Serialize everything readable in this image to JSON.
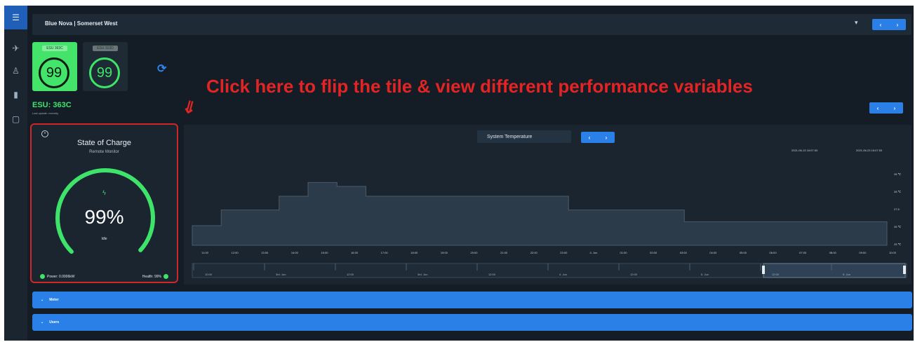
{
  "header": {
    "title": "Blue Nova | Somerset West",
    "nav_prev": "‹",
    "nav_next": "›"
  },
  "tiles": [
    {
      "label": "ESU 363C",
      "value": "99",
      "bg": "#44e46b",
      "ring": "#0b1a12",
      "text": "#0b1a12"
    },
    {
      "label": "ESU 313D",
      "value": "99",
      "bg": "#1e2a34",
      "ring": "#3ee46a",
      "text": "#3ee46a"
    }
  ],
  "annotation": "Click here to flip the tile & view different performance variables",
  "esu": {
    "title": "ESU: 363C",
    "subtitle": "Last update: recently"
  },
  "soc_card": {
    "title": "State of Charge",
    "subtitle": "Remote Monitor",
    "percent": "99%",
    "percent_value": 99,
    "state": "Idle",
    "power": "Power: 0.0006kW",
    "health": "Health: 99%"
  },
  "chart_panel": {
    "selector": "System Temperature",
    "range_from": "2021-06-13 16:07:53",
    "range_to": "2021-06-23 16:07:53"
  },
  "chart_data": {
    "type": "area",
    "step": true,
    "ylabel": "",
    "yticks": [
      "28 ℃",
      "28 ℃",
      "27.5",
      "26 ℃",
      "25 ℃"
    ],
    "x": [
      "11:00",
      "12:00",
      "13:00",
      "14:00",
      "15:00",
      "16:00",
      "17:00",
      "18:00",
      "19:00",
      "20:00",
      "21:00",
      "22:00",
      "23:00",
      "4. Jun",
      "01:00",
      "02:00",
      "03:00",
      "04:00",
      "05:00",
      "06:00",
      "07:00",
      "08:00",
      "09:00",
      "10:00"
    ],
    "series": [
      {
        "values": [
          26.0,
          26.8,
          26.8,
          27.5,
          28.2,
          28.0,
          27.5,
          27.5,
          27.5,
          27.5,
          27.5,
          27.5,
          27.5,
          26.8,
          26.8,
          26.8,
          26.8,
          26.2,
          26.2,
          26.2,
          26.2,
          26.2,
          26.2,
          26.2
        ]
      }
    ],
    "navigator_labels": [
      "10:00",
      "3rd. Jun",
      "12:00",
      "3rd. Jun",
      "12:00",
      "4. Jun",
      "12:00",
      "5. Jun",
      "12:00",
      "5. Jun"
    ],
    "colors": {
      "fill": "#2c3b49",
      "line": "#4a5a6a",
      "accent": "#2a80e6"
    }
  },
  "accordions": [
    {
      "label": "Meter"
    },
    {
      "label": "Users"
    }
  ]
}
